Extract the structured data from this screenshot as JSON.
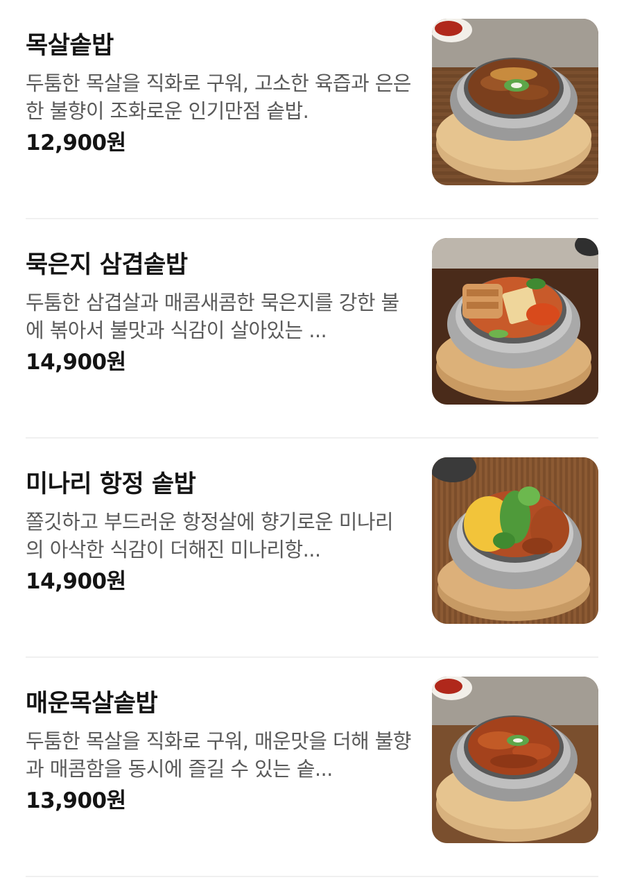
{
  "menu": {
    "items": [
      {
        "name": "목살솥밥",
        "description": "두툼한 목살을 직화로 구워, 고소한 육즙과 은은한 불향이 조화로운 인기만점 솥밥.",
        "price": "12,900원",
        "photo_icon": "pork-neck-pot-rice-photo"
      },
      {
        "name": "묵은지 삼겹솥밥",
        "description": "두툼한 삼겹살과 매콤새콤한 묵은지를 강한 불에 볶아서 불맛과 식감이 살아있는 ...",
        "price": "14,900원",
        "photo_icon": "kimchi-pork-belly-pot-rice-photo"
      },
      {
        "name": "미나리 항정 솥밥",
        "description": "쫄깃하고 부드러운 항정살에 향기로운 미나리의 아삭한 식감이 더해진 미나리항...",
        "price": "14,900원",
        "photo_icon": "minari-jowl-pot-rice-photo"
      },
      {
        "name": "매운목살솥밥",
        "description": "두툼한 목살을 직화로 구워, 매운맛을 더해 불향과 매콤함을 동시에 즐길 수 있는 솥...",
        "price": "13,900원",
        "photo_icon": "spicy-pork-neck-pot-rice-photo"
      }
    ]
  }
}
